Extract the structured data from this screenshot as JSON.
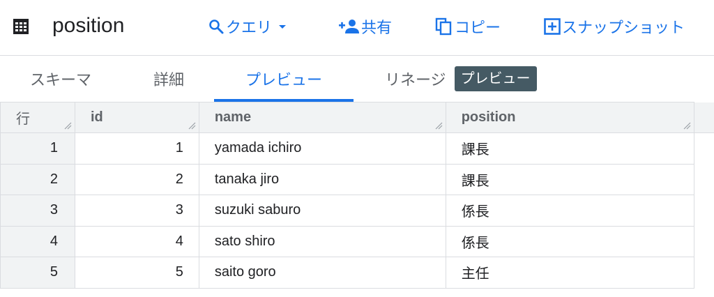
{
  "header": {
    "title": "position",
    "actions": [
      {
        "name": "query-button",
        "icon": "search-icon",
        "label": "クエリ"
      },
      {
        "name": "share-button",
        "icon": "person-add-icon",
        "label": "共有"
      },
      {
        "name": "copy-button",
        "icon": "copy-icon",
        "label": "コピー"
      },
      {
        "name": "snapshot-button",
        "icon": "add-box-icon",
        "label": "スナップショット"
      }
    ]
  },
  "tabs": [
    {
      "label": "スキーマ",
      "active": false
    },
    {
      "label": "詳細",
      "active": false
    },
    {
      "label": "プレビュー",
      "active": true
    },
    {
      "label": "リネージ",
      "active": false,
      "badge": "プレビュー"
    }
  ],
  "table": {
    "columns": [
      "行",
      "id",
      "name",
      "position"
    ],
    "rows": [
      {
        "row": "1",
        "id": "1",
        "name": "yamada ichiro",
        "position": "課長"
      },
      {
        "row": "2",
        "id": "2",
        "name": "tanaka jiro",
        "position": "課長"
      },
      {
        "row": "3",
        "id": "3",
        "name": "suzuki saburo",
        "position": "係長"
      },
      {
        "row": "4",
        "id": "4",
        "name": "sato shiro",
        "position": "係長"
      },
      {
        "row": "5",
        "id": "5",
        "name": "saito goro",
        "position": "主任"
      }
    ]
  },
  "colors": {
    "accent": "#1a73e8",
    "badge_bg": "#455a64",
    "header_bg": "#f1f3f4",
    "border": "#dadce0"
  }
}
